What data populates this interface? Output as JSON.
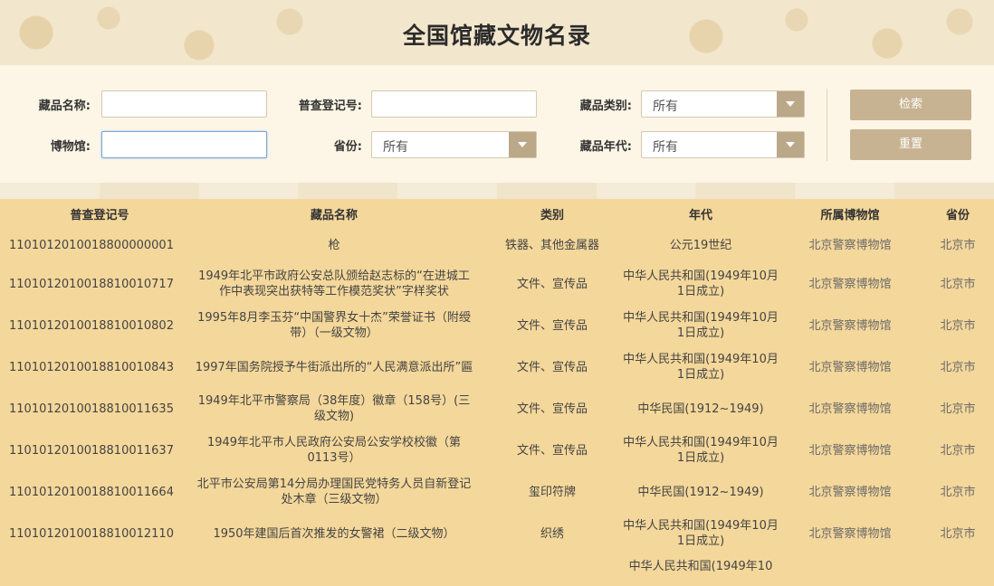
{
  "page": {
    "title": "全国馆藏文物名录"
  },
  "filters": {
    "name_label": "藏品名称:",
    "name_value": "",
    "reg_label": "普查登记号:",
    "reg_value": "",
    "category_label": "藏品类别:",
    "category_value": "所有",
    "museum_label": "博物馆:",
    "museum_value": "",
    "province_label": "省份:",
    "province_value": "所有",
    "era_label": "藏品年代:",
    "era_value": "所有",
    "search_button": "检索",
    "reset_button": "重置"
  },
  "table": {
    "headers": [
      "普查登记号",
      "藏品名称",
      "类别",
      "年代",
      "所属博物馆",
      "省份"
    ],
    "rows": [
      [
        "1101012010018800000001",
        "枪",
        "铁器、其他金属器",
        "公元19世纪",
        "北京警察博物馆",
        "北京市"
      ],
      [
        "1101012010018810010717",
        "1949年北平市政府公安总队颁给赵志标的“在进城工作中表现突出获特等工作模范奖状”字样奖状",
        "文件、宣传品",
        "中华人民共和国(1949年10月1日成立)",
        "北京警察博物馆",
        "北京市"
      ],
      [
        "1101012010018810010802",
        "1995年8月李玉芬“中国警界女十杰”荣誉证书（附绶带）（一级文物）",
        "文件、宣传品",
        "中华人民共和国(1949年10月1日成立)",
        "北京警察博物馆",
        "北京市"
      ],
      [
        "1101012010018810010843",
        "1997年国务院授予牛街派出所的“人民满意派出所”匾",
        "文件、宣传品",
        "中华人民共和国(1949年10月1日成立)",
        "北京警察博物馆",
        "北京市"
      ],
      [
        "1101012010018810011635",
        "1949年北平市警察局（38年度）徽章（158号）(三级文物)",
        "文件、宣传品",
        "中华民国(1912~1949)",
        "北京警察博物馆",
        "北京市"
      ],
      [
        "1101012010018810011637",
        "1949年北平市人民政府公安局公安学校校徽（第0113号）",
        "文件、宣传品",
        "中华人民共和国(1949年10月1日成立)",
        "北京警察博物馆",
        "北京市"
      ],
      [
        "1101012010018810011664",
        "北平市公安局第14分局办理国民党特务人员自新登记处木章（三级文物）",
        "玺印符牌",
        "中华民国(1912~1949)",
        "北京警察博物馆",
        "北京市"
      ],
      [
        "1101012010018810012110",
        "1950年建国后首次推发的女警裙（二级文物）",
        "织绣",
        "中华人民共和国(1949年10月1日成立)",
        "北京警察博物馆",
        "北京市"
      ],
      [
        "",
        "",
        "",
        "中华人民共和国(1949年10",
        "",
        ""
      ]
    ]
  }
}
